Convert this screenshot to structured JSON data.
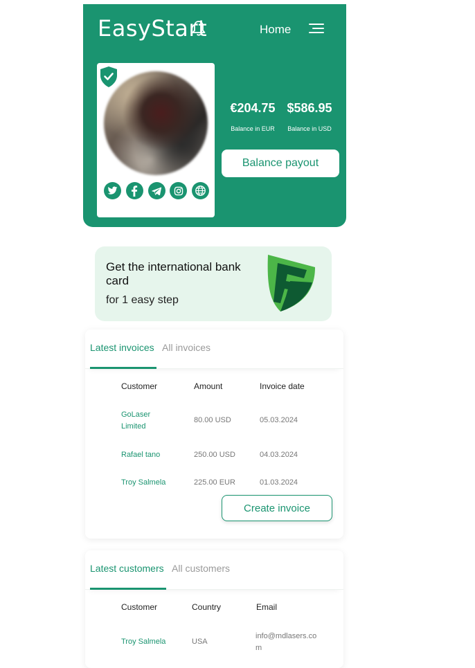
{
  "header": {
    "brand": "EasyStart",
    "nav_home": "Home"
  },
  "profile": {
    "social_icons": [
      "twitter-icon",
      "facebook-icon",
      "telegram-icon",
      "instagram-icon",
      "globe-icon"
    ]
  },
  "balances": [
    {
      "amount": "€204.75",
      "label": "Balance in EUR"
    },
    {
      "amount": "$586.95",
      "label": "Balance in USD"
    }
  ],
  "payout_button": "Balance payout",
  "promo": {
    "title": "Get the international bank card",
    "subtitle": "for 1 easy step"
  },
  "invoices": {
    "tabs": [
      "Latest invoices",
      "All invoices"
    ],
    "columns": [
      "Customer",
      "Amount",
      "Invoice date"
    ],
    "rows": [
      {
        "customer": "GoLaser Limited",
        "amount": "80.00 USD",
        "date": "05.03.2024"
      },
      {
        "customer": "Rafael tano",
        "amount": "250.00 USD",
        "date": "04.03.2024"
      },
      {
        "customer": "Troy Salmela",
        "amount": "225.00 EUR",
        "date": "01.03.2024"
      }
    ],
    "create_button": "Create invoice"
  },
  "customers": {
    "tabs": [
      "Latest customers",
      "All customers"
    ],
    "columns": [
      "Customer",
      "Country",
      "Email"
    ],
    "rows": [
      {
        "customer": "Troy Salmela",
        "country": "USA",
        "email": "info@mdlasers.com"
      }
    ]
  },
  "colors": {
    "brand_green": "#1a9470",
    "promo_bg": "#e6f5ec"
  }
}
